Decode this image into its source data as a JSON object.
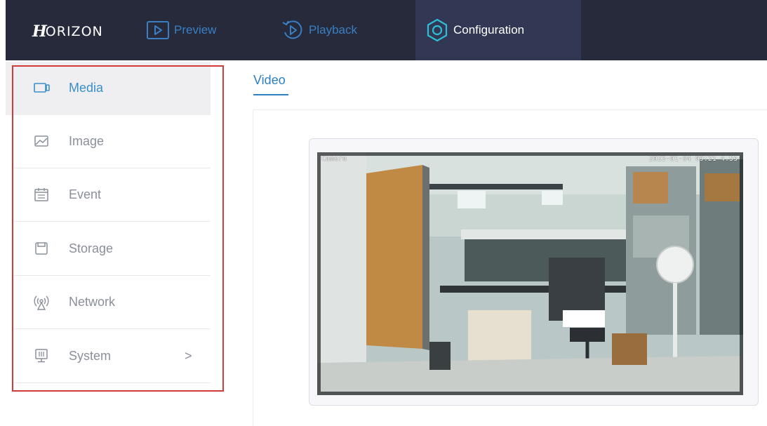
{
  "header": {
    "logo_mark": "H",
    "logo_word": "ORIZON",
    "tabs": [
      {
        "label": "Preview",
        "icon": "play-square-icon"
      },
      {
        "label": "Playback",
        "icon": "replay-icon"
      },
      {
        "label": "Configuration",
        "icon": "config-ring-icon",
        "active": true
      }
    ]
  },
  "sidebar": {
    "items": [
      {
        "label": "Media",
        "icon": "camera-icon",
        "active": true
      },
      {
        "label": "Image",
        "icon": "image-icon"
      },
      {
        "label": "Event",
        "icon": "calendar-icon"
      },
      {
        "label": "Storage",
        "icon": "storage-icon"
      },
      {
        "label": "Network",
        "icon": "antenna-icon"
      },
      {
        "label": "System",
        "icon": "monitor-icon",
        "chevron": ">"
      }
    ]
  },
  "content": {
    "subtab": "Video",
    "osd_left": "Camera",
    "osd_right": "2023-01-04 09:21 4.5s"
  },
  "colors": {
    "topbar": "#262a3b",
    "active_tab": "#323754",
    "accent": "#3a8fc7",
    "highlight_border": "#d33a3a"
  }
}
